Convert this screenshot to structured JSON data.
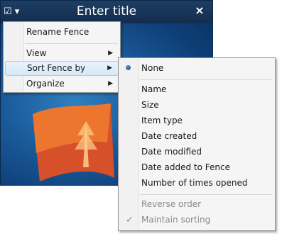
{
  "fence": {
    "title": "Enter title",
    "menu_button_glyph": "☑ ▾",
    "close_glyph": "×"
  },
  "context_menu": {
    "items": [
      {
        "label": "Rename Fence"
      },
      {
        "label": "View",
        "submenu_arrow": "▶"
      },
      {
        "label": "Sort Fence by",
        "submenu_arrow": "▶",
        "highlighted": true
      },
      {
        "label": "Organize",
        "submenu_arrow": "▶"
      }
    ]
  },
  "sort_submenu": {
    "items": [
      {
        "label": "None",
        "selected": true
      },
      {
        "label": "Name"
      },
      {
        "label": "Size"
      },
      {
        "label": "Item type"
      },
      {
        "label": "Date created"
      },
      {
        "label": "Date modified"
      },
      {
        "label": "Date added to Fence"
      },
      {
        "label": "Number of times opened"
      },
      {
        "label": "Reverse order",
        "disabled": true
      },
      {
        "label": "Maintain sorting",
        "disabled": true,
        "checked": true
      }
    ],
    "check_glyph": "✓"
  }
}
